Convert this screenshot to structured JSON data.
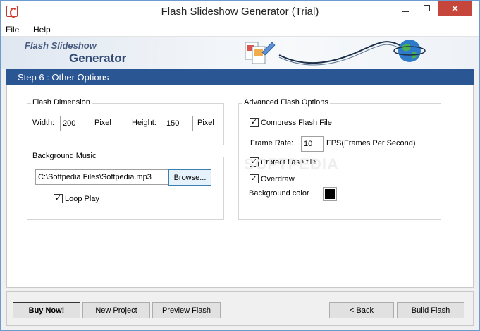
{
  "window": {
    "title": "Flash Slideshow Generator (Trial)"
  },
  "menu": {
    "items": [
      "File",
      "Help"
    ]
  },
  "banner": {
    "line1": "Flash Slideshow",
    "line2": "Generator"
  },
  "step": {
    "title": "Step 6 : Other Options"
  },
  "flash_dimension": {
    "group_label": "Flash Dimension",
    "width_label": "Width:",
    "width_value": "200",
    "width_unit": "Pixel",
    "height_label": "Height:",
    "height_value": "150",
    "height_unit": "Pixel"
  },
  "background_music": {
    "group_label": "Background Music",
    "file_path": "C:\\Softpedia Files\\Softpedia.mp3",
    "browse_label": "Browse...",
    "loop_label": "Loop Play",
    "loop_checked": true
  },
  "advanced": {
    "group_label": "Advanced Flash Options",
    "compress_label": "Compress Flash File",
    "compress_checked": true,
    "frame_rate_label": "Frame Rate:",
    "frame_rate_value": "10",
    "frame_rate_unit": "FPS(Frames Per Second)",
    "protect_label": "Protect flash file",
    "protect_checked": true,
    "overdraw_label": "Overdraw",
    "overdraw_checked": true,
    "bg_color_label": "Background color",
    "bg_color_value": "#000000"
  },
  "watermark": "SOFTPEDIA",
  "buttons": {
    "buy_now": "Buy Now!",
    "new_project": "New Project",
    "preview_flash": "Preview Flash",
    "back": "< Back",
    "build_flash": "Build Flash"
  },
  "colors": {
    "step_bar": "#2b5694",
    "close_button": "#c7463b"
  }
}
